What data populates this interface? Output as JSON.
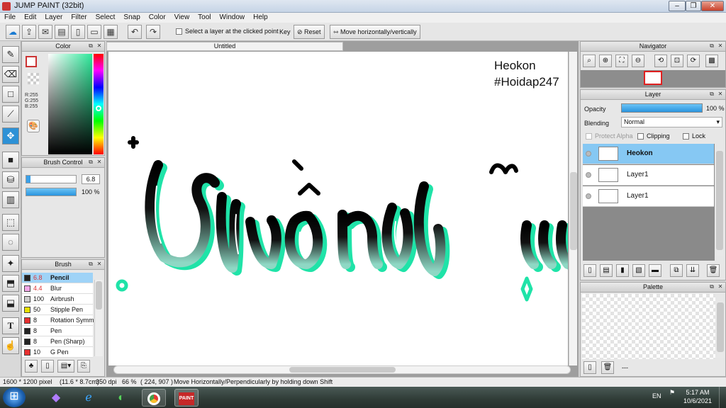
{
  "window": {
    "title": "JUMP PAINT (32bit)"
  },
  "menu": [
    "File",
    "Edit",
    "Layer",
    "Filter",
    "Select",
    "Snap",
    "Color",
    "View",
    "Tool",
    "Window",
    "Help"
  ],
  "toolbar": {
    "select_layer_label": "Select a layer at the clicked point",
    "key_label": "Key",
    "reset_label": "Reset",
    "move_label": "Move horizontally/vertically"
  },
  "color_panel": {
    "title": "Color",
    "r": "R:255",
    "g": "G:255",
    "b": "B:255"
  },
  "brush_control": {
    "title": "Brush Control",
    "size": "6.8",
    "opacity": "100 %"
  },
  "brush_panel": {
    "title": "Brush",
    "items": [
      {
        "size": "6.8",
        "name": "Pencil",
        "color": "#222222",
        "selected": true
      },
      {
        "size": "4.4",
        "name": "Blur",
        "color": "#f2a6e8",
        "selected": false
      },
      {
        "size": "100",
        "name": "Airbrush",
        "color": "#cccccc",
        "selected": false
      },
      {
        "size": "50",
        "name": "Stipple Pen",
        "color": "#e8e000",
        "selected": false
      },
      {
        "size": "8",
        "name": "Rotation Symm",
        "color": "#e83030",
        "selected": false
      },
      {
        "size": "8",
        "name": "Pen",
        "color": "#222222",
        "selected": false
      },
      {
        "size": "8",
        "name": "Pen (Sharp)",
        "color": "#222222",
        "selected": false
      },
      {
        "size": "10",
        "name": "G Pen",
        "color": "#e83030",
        "selected": false
      }
    ]
  },
  "document": {
    "tab": "Untitled"
  },
  "canvas": {
    "text_line1": "Heokon",
    "text_line2": "#Hoidap247"
  },
  "navigator": {
    "title": "Navigator"
  },
  "layer_panel": {
    "title": "Layer",
    "opacity_label": "Opacity",
    "opacity_value": "100 %",
    "blending_label": "Blending",
    "blending_value": "Normal",
    "protect_alpha": "Protect Alpha",
    "clipping": "Clipping",
    "lock": "Lock",
    "layers": [
      {
        "name": "Heokon",
        "selected": true
      },
      {
        "name": "Layer1",
        "selected": false
      },
      {
        "name": "Layer1",
        "selected": false
      }
    ]
  },
  "palette": {
    "title": "Palette",
    "dash": "---"
  },
  "status": {
    "size": "1600 * 1200 pixel",
    "cm": "(11.6 * 8.7cm)",
    "dpi": "350 dpi",
    "zoom": "66 %",
    "coords": "( 224, 907 )",
    "hint": "Move Horizontally/Perpendicularly by holding down Shift"
  },
  "taskbar": {
    "lang": "EN",
    "time": "5:17 AM",
    "date": "10/6/2021"
  }
}
